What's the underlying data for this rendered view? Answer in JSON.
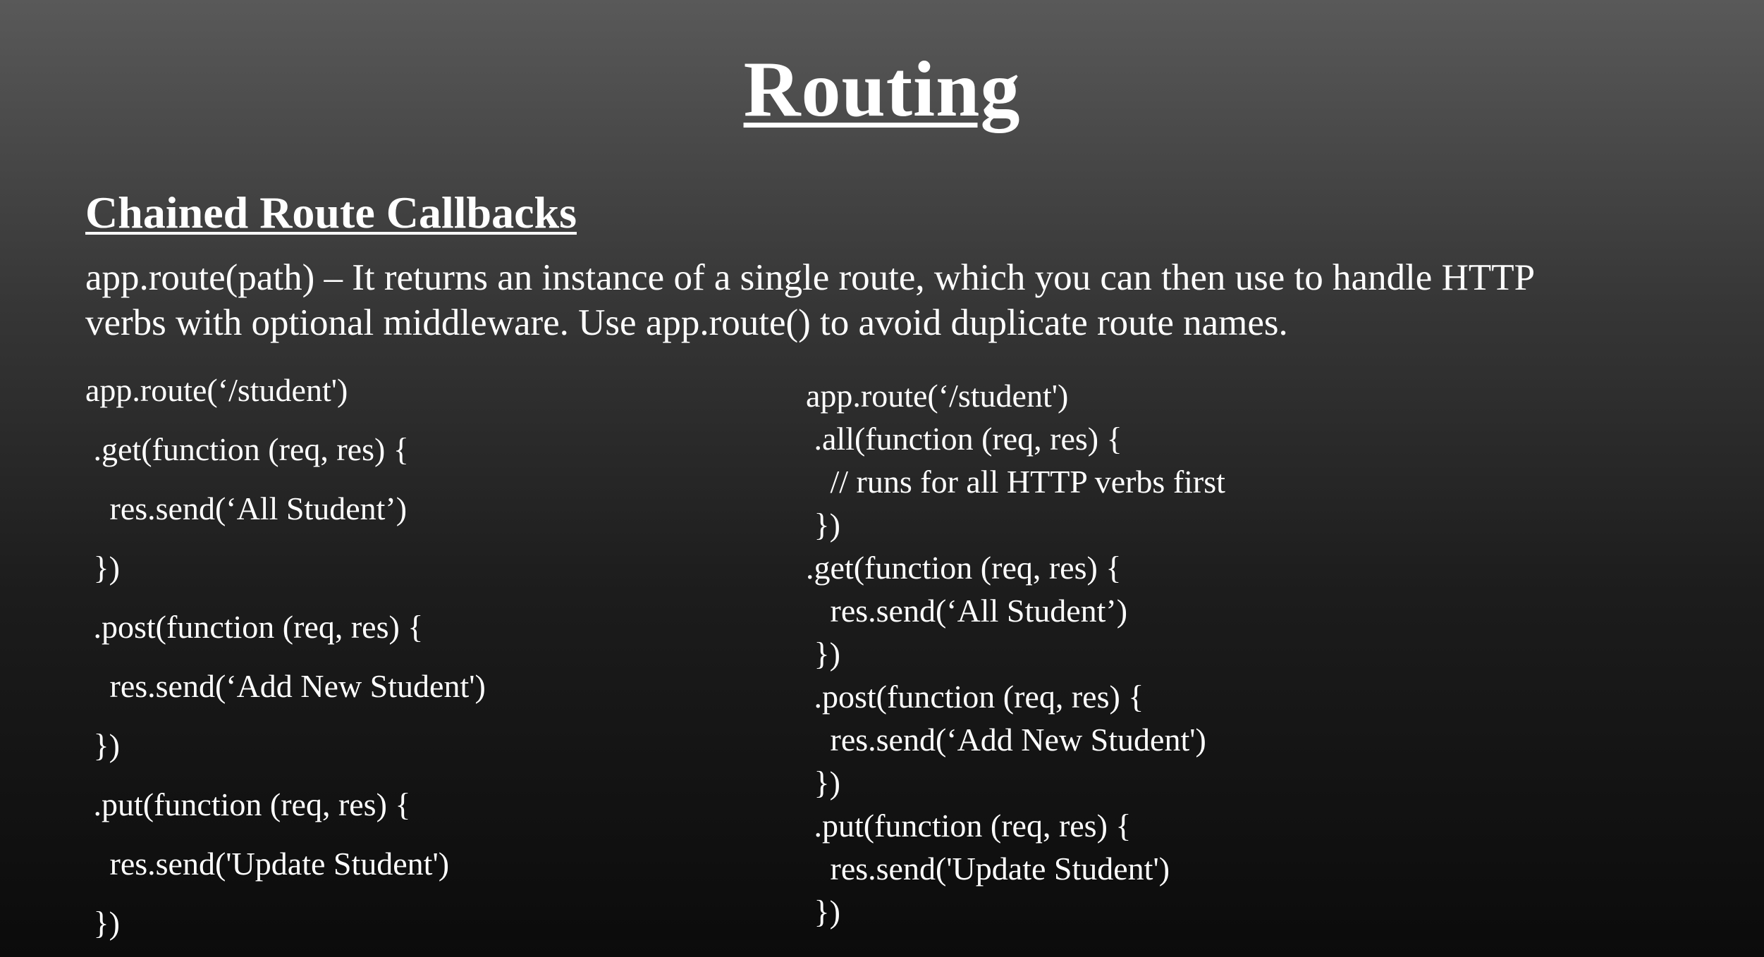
{
  "slide": {
    "title": "Routing",
    "subtitle": "Chained Route Callbacks",
    "description": [
      "app.route(path) – It returns an instance of a single route, which you can then use to handle HTTP",
      "verbs with optional middleware. Use app.route() to avoid duplicate route names."
    ],
    "code_left": [
      "app.route(‘/student')",
      " .get(function (req, res) {",
      "   res.send(‘All Student’)",
      " })",
      " .post(function (req, res) {",
      "   res.send(‘Add New Student')",
      " })",
      " .put(function (req, res) {",
      "   res.send('Update Student')",
      " })"
    ],
    "code_right": [
      "app.route(‘/student')",
      " .all(function (req, res) {",
      "   // runs for all HTTP verbs first",
      " })",
      ".get(function (req, res) {",
      "   res.send(‘All Student’)",
      " })",
      " .post(function (req, res) {",
      "   res.send(‘Add New Student')",
      " })",
      " .put(function (req, res) {",
      "   res.send('Update Student')",
      " })"
    ]
  }
}
